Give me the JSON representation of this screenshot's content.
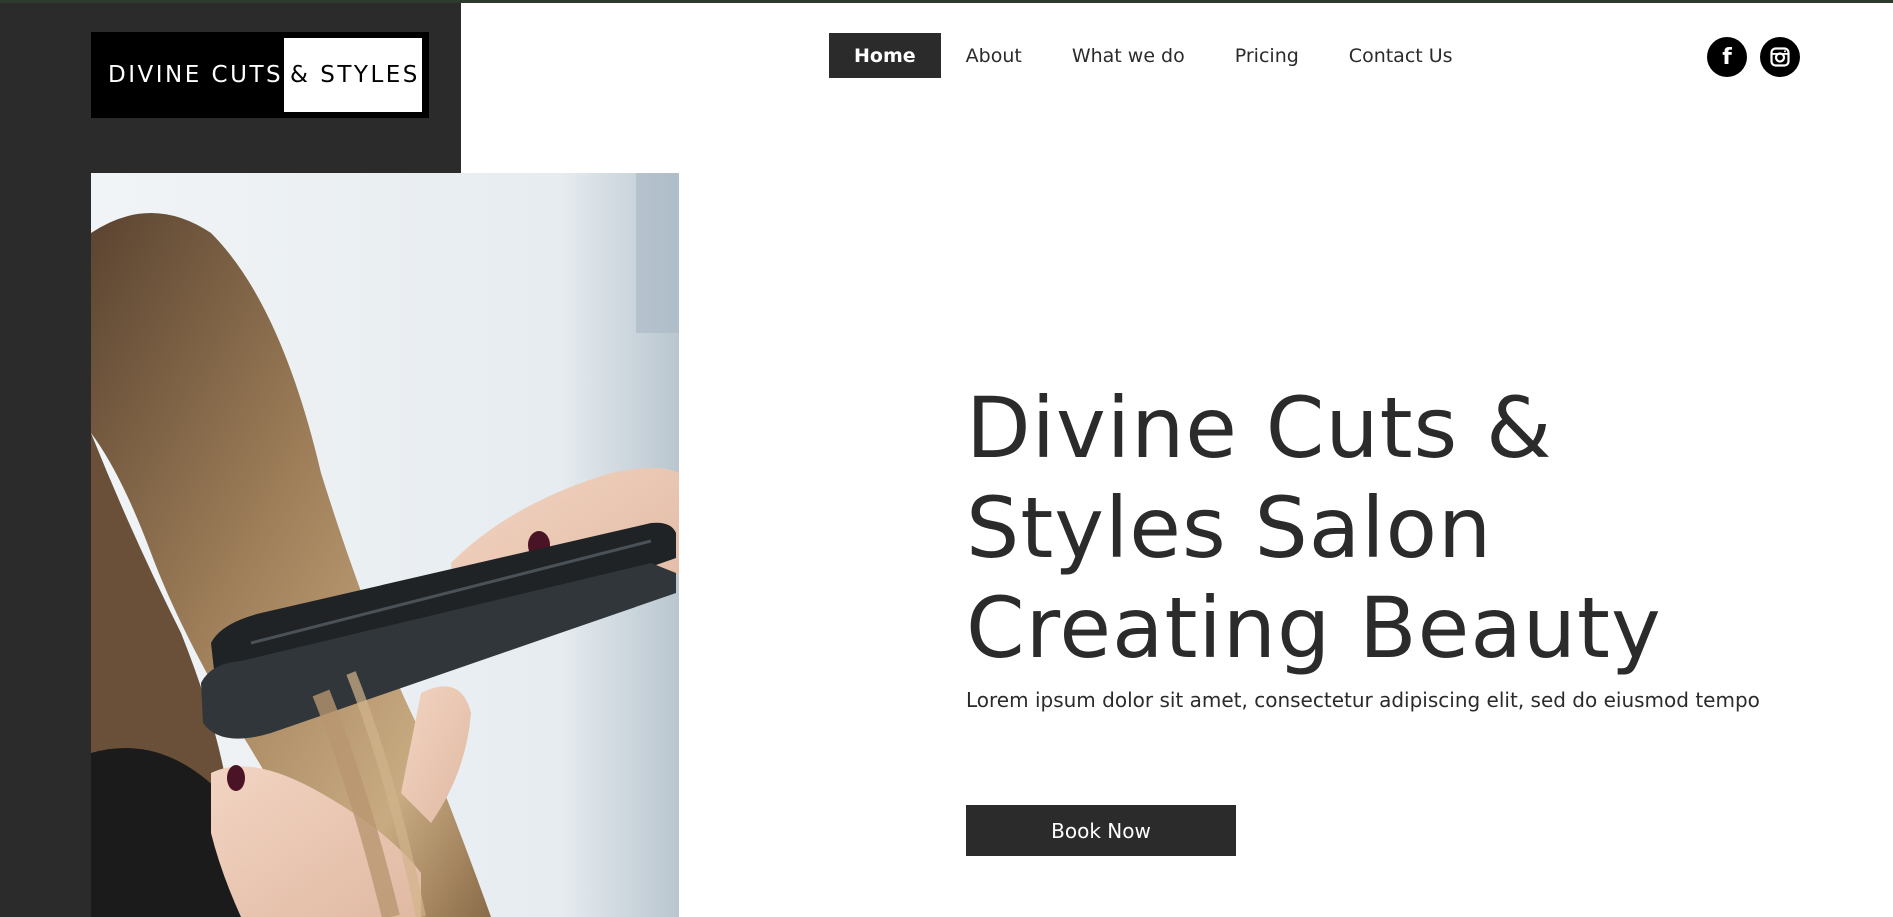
{
  "logo": {
    "part1": "DIVINE CUTS",
    "part2": "& STYLES"
  },
  "nav": {
    "items": [
      {
        "label": "Home",
        "active": true
      },
      {
        "label": "About"
      },
      {
        "label": "What we do"
      },
      {
        "label": "Pricing"
      },
      {
        "label": "Contact Us"
      }
    ]
  },
  "social": {
    "facebook_icon": "facebook-icon",
    "instagram_icon": "instagram-icon"
  },
  "hero": {
    "title_line1": "Divine Cuts &",
    "title_line2": "Styles Salon",
    "title_line3": "Creating Beauty",
    "subtitle": "Lorem ipsum dolor sit amet, consectetur adipiscing elit, sed do eiusmod tempo",
    "cta_label": "Book Now"
  },
  "colors": {
    "dark": "#2b2b2b",
    "black": "#000000",
    "white": "#ffffff"
  }
}
